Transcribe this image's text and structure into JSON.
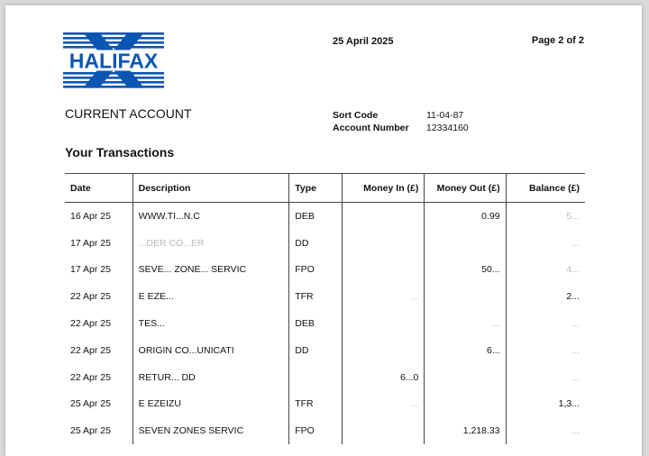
{
  "brand": {
    "name": "HALIFAX",
    "color": "#0b55b3"
  },
  "header": {
    "date": "25 April 2025",
    "page": "Page 2 of 2"
  },
  "account": {
    "title": "CURRENT ACCOUNT",
    "sort_code_label": "Sort Code",
    "sort_code": "11-04-87",
    "account_number_label": "Account Number",
    "account_number": "12334160"
  },
  "transactions": {
    "title": "Your Transactions",
    "columns": [
      "Date",
      "Description",
      "Type",
      "Money In (£)",
      "Money Out (£)",
      "Balance (£)"
    ],
    "rows": [
      {
        "date": "16 Apr 25",
        "description": "WWW.TI...N.C",
        "type": "DEB",
        "money_in": "",
        "money_out": "0.99",
        "balance": "5..."
      },
      {
        "date": "17 Apr 25",
        "description": "...DER CO...ER",
        "type": "DD",
        "money_in": "",
        "money_out": "",
        "balance": "..."
      },
      {
        "date": "17 Apr 25",
        "description": "SEVE... ZONE... SERVIC",
        "type": "FPO",
        "money_in": "",
        "money_out": "50...",
        "balance": "4..."
      },
      {
        "date": "22 Apr 25",
        "description": "E EZE...",
        "type": "TFR",
        "money_in": "...",
        "money_out": "",
        "balance": "2..."
      },
      {
        "date": "22 Apr 25",
        "description": "TES...",
        "type": "DEB",
        "money_in": "",
        "money_out": "...",
        "balance": "..."
      },
      {
        "date": "22 Apr 25",
        "description": "ORIGIN CO...UNICATI",
        "type": "DD",
        "money_in": "",
        "money_out": "6...",
        "balance": "..."
      },
      {
        "date": "22 Apr 25",
        "description": "RETUR... DD",
        "type": "",
        "money_in": "6...0",
        "money_out": "",
        "balance": "..."
      },
      {
        "date": "25 Apr 25",
        "description": "E EZEIZU",
        "type": "TFR",
        "money_in": "...",
        "money_out": "",
        "balance": "1,3..."
      },
      {
        "date": "25 Apr 25",
        "description": "SEVEN ZONES SERVIC",
        "type": "FPO",
        "money_in": "",
        "money_out": "1,218.33",
        "balance": "..."
      }
    ]
  }
}
